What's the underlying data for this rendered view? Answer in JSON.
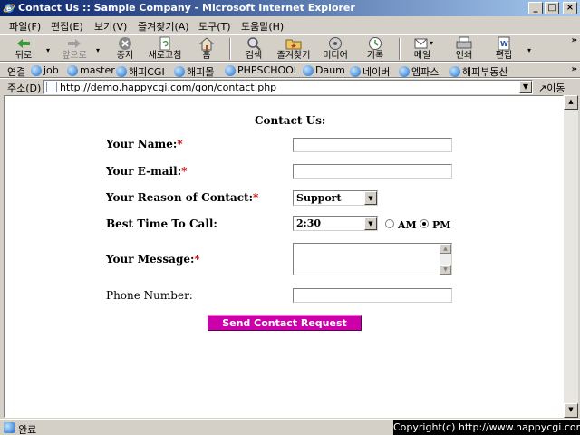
{
  "window": {
    "title": "Contact Us :: Sample Company - Microsoft Internet Explorer",
    "min": "_",
    "max": "□",
    "close": "×"
  },
  "menu": [
    "파일(F)",
    "편집(E)",
    "보기(V)",
    "즐겨찾기(A)",
    "도구(T)",
    "도움말(H)"
  ],
  "toolbar": {
    "back": "뒤로",
    "forward": "앞으로",
    "stop": "중지",
    "refresh": "새로고침",
    "home": "홈",
    "search": "검색",
    "favorites": "즐겨찾기",
    "media": "미디어",
    "history": "기록",
    "mail": "메일",
    "print": "인쇄",
    "edit": "편집",
    "more": "»"
  },
  "links": {
    "label": "연결",
    "items": [
      "job",
      "master",
      "해피CGI",
      "해피몰",
      "PHPSCHOOL",
      "Daum",
      "네이버",
      "엠파스",
      "해피부동산"
    ],
    "more": "»"
  },
  "address": {
    "label": "주소(D)",
    "url": "http://demo.happycgi.com/gon/contact.php",
    "go": "이동"
  },
  "form": {
    "title": "Contact Us:",
    "required_mark": "*",
    "name_label": "Your Name:",
    "email_label": "Your E-mail:",
    "reason_label": "Your Reason of Contact:",
    "reason_value": "Support",
    "time_label": "Best Time To Call:",
    "time_value": "2:30",
    "am": "AM",
    "pm": "PM",
    "selected_period": "PM",
    "message_label": "Your Message:",
    "phone_label": "Phone Number:",
    "submit": "Send Contact Request"
  },
  "status": {
    "text": "완료",
    "copyright": "Copyright(c) http://www.happycgi.com"
  },
  "colors": {
    "submit_bg": "#cc00aa",
    "required": "#c00000",
    "title_bar": "#0a246a"
  }
}
